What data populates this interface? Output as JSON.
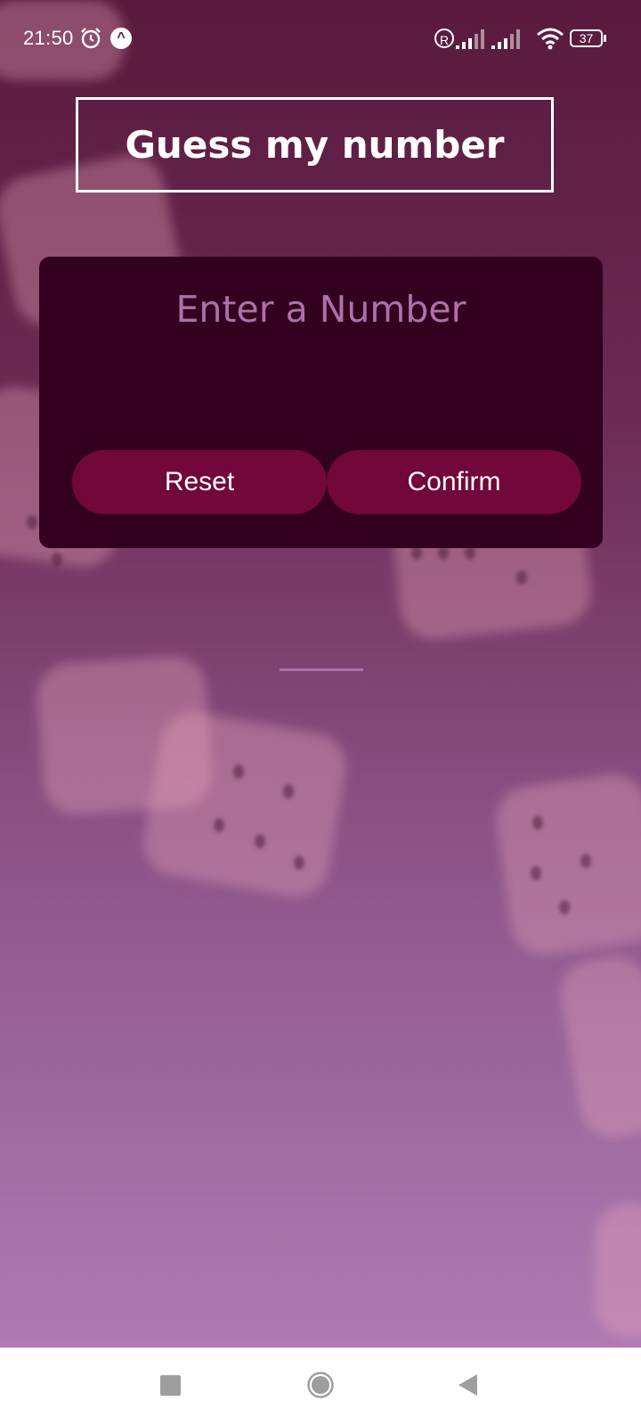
{
  "status_bar": {
    "time": "21:50",
    "battery_level": "37",
    "icons": [
      "alarm-icon",
      "a-notification-icon",
      "roaming-icon",
      "signal-icon",
      "signal-icon",
      "wifi-icon",
      "battery-icon"
    ]
  },
  "header": {
    "title": "Guess my number"
  },
  "input_card": {
    "heading": "Enter a Number",
    "input_value": "",
    "reset_label": "Reset",
    "confirm_label": "Confirm"
  },
  "nav_bar": {
    "icons": [
      "recent-apps-icon",
      "home-icon",
      "back-icon"
    ]
  },
  "colors": {
    "card_background": "#330020",
    "button_background": "#72073a",
    "accent_text": "#b070a8",
    "gradient_top": "#5a1a3e",
    "gradient_bottom": "#b07ab2"
  }
}
